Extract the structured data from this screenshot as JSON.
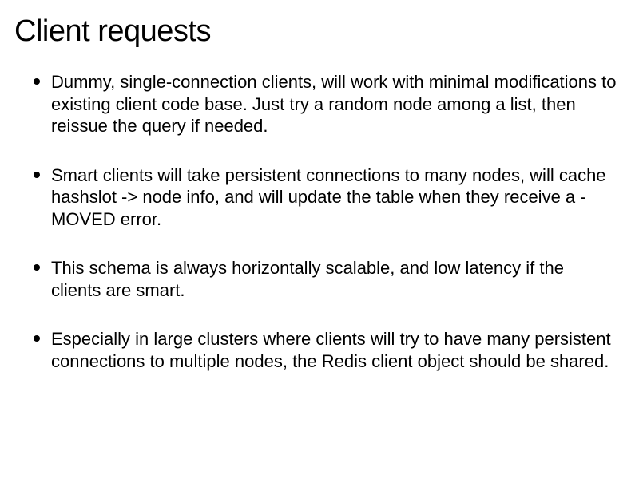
{
  "title": "Client requests",
  "bullets": [
    "Dummy, single-connection clients, will work with minimal modifications to existing client code base. Just try a random node among a list, then reissue the query if needed.",
    "Smart clients will take persistent connections to many nodes, will cache hashslot -> node info, and will update the table when they receive a -MOVED error.",
    "This schema is always horizontally scalable, and low latency if the clients are smart.",
    "Especially in large clusters where clients will try to have many persistent connections to multiple nodes, the Redis client object should be shared."
  ]
}
